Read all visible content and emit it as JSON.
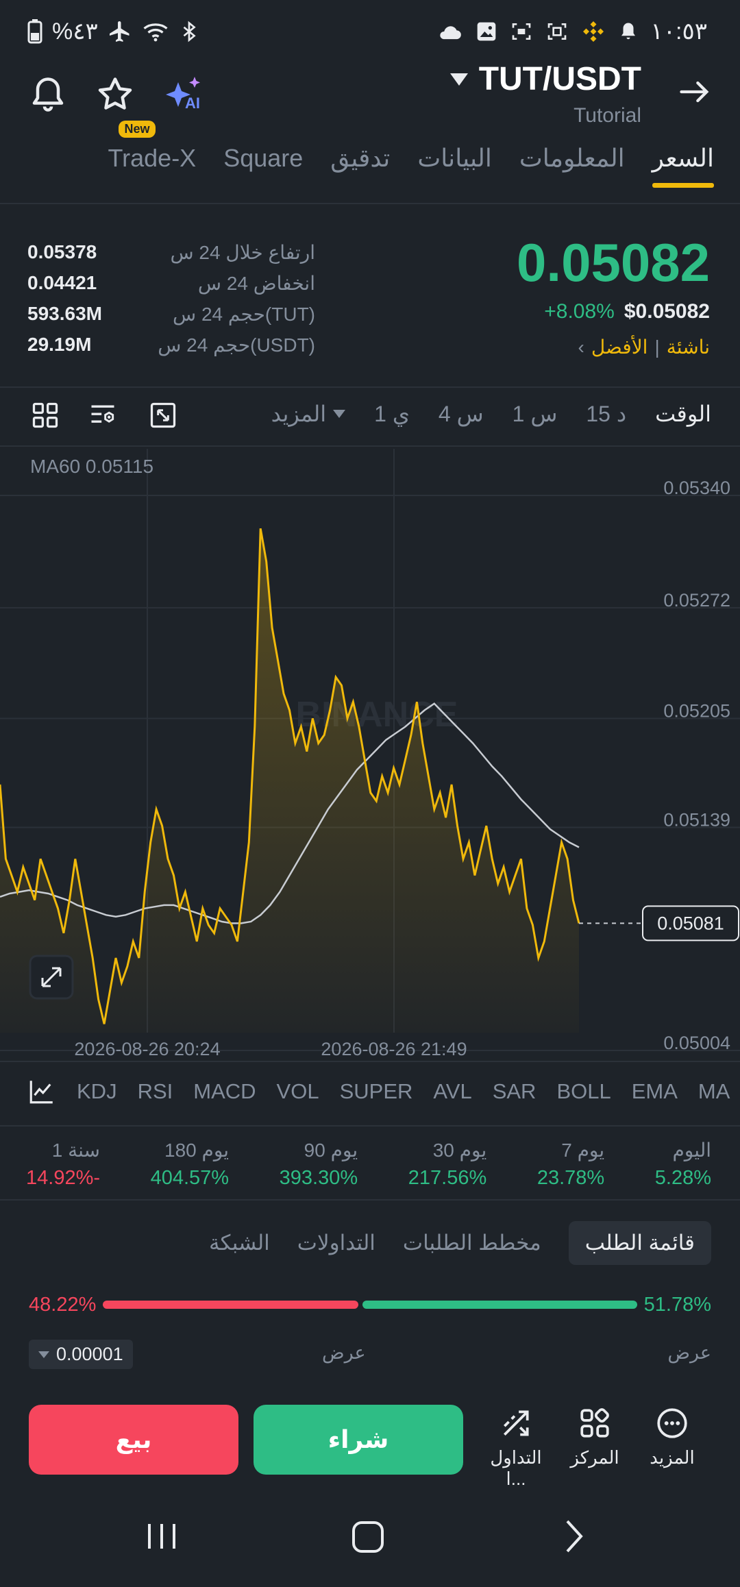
{
  "status_bar": {
    "battery": "%٤٣",
    "time": "١٠:٥٣"
  },
  "header": {
    "pair": "TUT/USDT",
    "subtitle": "Tutorial",
    "ai_label": "AI"
  },
  "tabs": [
    {
      "label": "السعر",
      "active": true
    },
    {
      "label": "المعلومات"
    },
    {
      "label": "البيانات"
    },
    {
      "label": "تدقيق"
    },
    {
      "label": "Square"
    },
    {
      "label": "Trade-X",
      "badge": "New"
    }
  ],
  "price": {
    "last": "0.05082",
    "change": "+8.08%",
    "usd": "$0.05082",
    "tag_emerging": "ناشئة",
    "tag_best": "الأفضل"
  },
  "stats": [
    {
      "label": "ارتفاع خلال 24 س",
      "value": "0.05378"
    },
    {
      "label": "انخفاض 24 س",
      "value": "0.04421"
    },
    {
      "label": "حجم 24 س(TUT)",
      "value": "593.63M"
    },
    {
      "label": "حجم 24 س(USDT)",
      "value": "29.19M"
    }
  ],
  "time_row": {
    "items": [
      "الوقت",
      "15 د",
      "1 س",
      "4 س",
      "1 ي"
    ],
    "more": "المزيد"
  },
  "chart_data": {
    "type": "line",
    "ma_label": "MA60 0.05115",
    "y_ticks": [
      "0.05340",
      "0.05272",
      "0.05205",
      "0.05139",
      "0.05004"
    ],
    "last_price_tag": "0.05081",
    "x_labels": [
      "2026-08-26 20:24",
      "2026-08-26 21:49"
    ],
    "ylim": [
      0.05004,
      0.0534
    ],
    "watermark": "BINANCE",
    "series": [
      {
        "name": "price",
        "color": "#f0b90b",
        "values": [
          0.05165,
          0.0512,
          0.0511,
          0.051,
          0.05115,
          0.05105,
          0.05095,
          0.0512,
          0.0511,
          0.051,
          0.0509,
          0.05075,
          0.05095,
          0.0512,
          0.051,
          0.0508,
          0.0506,
          0.05035,
          0.0502,
          0.0504,
          0.0506,
          0.05045,
          0.05055,
          0.0507,
          0.0506,
          0.051,
          0.0513,
          0.0515,
          0.0514,
          0.0512,
          0.0511,
          0.0509,
          0.051,
          0.05085,
          0.0507,
          0.0509,
          0.0508,
          0.05075,
          0.0509,
          0.05085,
          0.0508,
          0.0507,
          0.051,
          0.0513,
          0.052,
          0.0532,
          0.053,
          0.0526,
          0.0524,
          0.0522,
          0.0521,
          0.0519,
          0.052,
          0.05185,
          0.05205,
          0.0519,
          0.05195,
          0.0521,
          0.0523,
          0.05225,
          0.05205,
          0.05215,
          0.052,
          0.0518,
          0.0516,
          0.05155,
          0.0517,
          0.0516,
          0.05175,
          0.05165,
          0.0518,
          0.05195,
          0.05215,
          0.0519,
          0.0517,
          0.0515,
          0.0516,
          0.05145,
          0.05165,
          0.0514,
          0.0512,
          0.0513,
          0.0511,
          0.05125,
          0.0514,
          0.0512,
          0.05105,
          0.05115,
          0.051,
          0.0511,
          0.0512,
          0.0509,
          0.0508,
          0.0506,
          0.0507,
          0.0509,
          0.0511,
          0.0513,
          0.0512,
          0.05095,
          0.05081
        ]
      },
      {
        "name": "MA60",
        "color": "#c8ccd2",
        "values": [
          0.05097,
          0.05099,
          0.051,
          0.05101,
          0.051,
          0.05099,
          0.05097,
          0.05095,
          0.05092,
          0.0509,
          0.05088,
          0.05086,
          0.05085,
          0.05086,
          0.05088,
          0.0509,
          0.05091,
          0.05092,
          0.05092,
          0.0509,
          0.05088,
          0.05086,
          0.05084,
          0.05082,
          0.05081,
          0.05081,
          0.05082,
          0.05086,
          0.05092,
          0.051,
          0.0511,
          0.0512,
          0.0513,
          0.0514,
          0.0515,
          0.05158,
          0.05166,
          0.05174,
          0.0518,
          0.05186,
          0.05192,
          0.05196,
          0.052,
          0.05205,
          0.0521,
          0.05214,
          0.05208,
          0.05202,
          0.05196,
          0.0519,
          0.05183,
          0.05176,
          0.0517,
          0.05163,
          0.05156,
          0.0515,
          0.05144,
          0.05138,
          0.05134,
          0.0513,
          0.05127
        ]
      }
    ]
  },
  "indicators": [
    "KDJ",
    "RSI",
    "MACD",
    "VOL",
    "SUPER",
    "AVL",
    "SAR",
    "BOLL",
    "EMA",
    "MA"
  ],
  "performance": [
    {
      "label": "اليوم",
      "value": "5.28%",
      "positive": true
    },
    {
      "label": "7 يوم",
      "value": "23.78%",
      "positive": true
    },
    {
      "label": "30 يوم",
      "value": "217.56%",
      "positive": true
    },
    {
      "label": "90 يوم",
      "value": "393.30%",
      "positive": true
    },
    {
      "label": "180 يوم",
      "value": "404.57%",
      "positive": true
    },
    {
      "label": "1 سنة",
      "value": "14.92%-",
      "positive": false
    }
  ],
  "order_tabs": [
    "قائمة الطلب",
    "مخطط الطلبات",
    "التداولات",
    "الشبكة"
  ],
  "ratio": {
    "sell_pct": "48.22%",
    "buy_pct": "51.78%",
    "sell_fraction": 0.4822
  },
  "depth": {
    "left_label": "عرض",
    "right_label": "عرض",
    "precision": "0.00001"
  },
  "bottom": {
    "sell": "بيع",
    "buy": "شراء",
    "more": "المزيد",
    "center": "المركز",
    "trade": "التداول ا..."
  }
}
